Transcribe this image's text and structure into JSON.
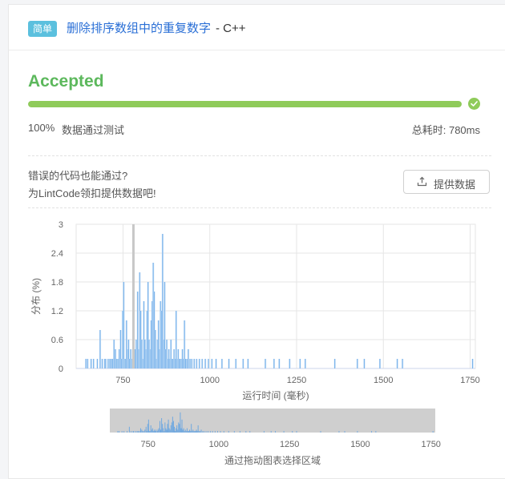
{
  "problem": {
    "difficulty": "简单",
    "title": "删除排序数组中的重复数字",
    "language": "- C++"
  },
  "result": {
    "status": "Accepted",
    "progress": 100,
    "pass_percent": "100%",
    "pass_label": "数据通过测试",
    "runtime_label": "总耗时: 780ms"
  },
  "contribute": {
    "line1": "错误的代码也能通过?",
    "line2": "为LintCode领扣提供数据吧!",
    "button_label": "提供数据"
  },
  "colors": {
    "accepted_green": "#5cb85c",
    "progress_green": "#8fcb5a",
    "badge_blue": "#5bc0de",
    "bar_blue": "#7cb5ec",
    "marker_gray": "#c8c8c8"
  },
  "chart_data": {
    "type": "bar",
    "xlabel": "运行时间 (毫秒)",
    "ylabel": "分布 (%)",
    "xlim": [
      615,
      1765
    ],
    "ylim": [
      0,
      3
    ],
    "x_ticks": [
      750,
      1000,
      1250,
      1500,
      1750
    ],
    "y_ticks": [
      0,
      0.6,
      1.2,
      1.8,
      2.4,
      3
    ],
    "y_tick_labels": [
      "0",
      "0.6",
      "1.2",
      "1.8",
      "2.4",
      "3"
    ],
    "grid": true,
    "current_runtime_marker": 780,
    "bars": {
      "x": [
        643,
        648,
        658,
        665,
        676,
        684,
        690,
        697,
        700,
        707,
        712,
        716,
        720,
        724,
        728,
        731,
        735,
        739,
        743,
        746,
        749,
        752,
        754,
        757,
        760,
        763,
        766,
        769,
        772,
        775,
        778,
        782,
        785,
        788,
        792,
        795,
        798,
        801,
        804,
        807,
        810,
        813,
        816,
        819,
        822,
        825,
        828,
        831,
        834,
        837,
        840,
        843,
        846,
        849,
        852,
        855,
        858,
        861,
        864,
        867,
        870,
        873,
        876,
        879,
        882,
        885,
        888,
        891,
        894,
        897,
        900,
        903,
        906,
        909,
        912,
        915,
        918,
        921,
        924,
        927,
        930,
        934,
        938,
        943,
        948,
        955,
        962,
        970,
        978,
        987,
        996,
        1006,
        1018,
        1035,
        1055,
        1075,
        1096,
        1110,
        1160,
        1185,
        1200,
        1230,
        1260,
        1275,
        1360,
        1425,
        1445,
        1490,
        1540,
        1555,
        1757
      ],
      "values": [
        0.2,
        0.2,
        0.2,
        0.2,
        0.2,
        0.8,
        0.2,
        0.2,
        0.2,
        0.2,
        0.2,
        0.2,
        0.2,
        0.6,
        0.4,
        0.2,
        0.2,
        0.4,
        0.8,
        0.2,
        1.2,
        1.8,
        0.2,
        0.2,
        1.0,
        0.4,
        0.6,
        0.2,
        0.4,
        0.2,
        0.4,
        0.2,
        0.4,
        0.6,
        1.6,
        0.4,
        2.0,
        1.2,
        0.6,
        0.2,
        1.4,
        0.6,
        0.4,
        1.2,
        1.8,
        0.6,
        0.4,
        1.0,
        1.4,
        2.2,
        1.6,
        0.8,
        0.2,
        0.6,
        1.0,
        0.4,
        1.4,
        1.2,
        2.8,
        0.6,
        1.8,
        0.4,
        0.6,
        0.2,
        0.4,
        0.2,
        0.6,
        0.2,
        0.2,
        0.4,
        0.2,
        1.2,
        0.2,
        0.4,
        0.2,
        0.2,
        0.2,
        0.4,
        0.2,
        1.0,
        0.2,
        0.2,
        0.4,
        0.2,
        0.2,
        0.2,
        0.2,
        0.2,
        0.2,
        0.2,
        0.2,
        0.2,
        0.2,
        0.2,
        0.2,
        0.2,
        0.2,
        0.2,
        0.2,
        0.2,
        0.2,
        0.2,
        0.2,
        0.2,
        0.2,
        0.2,
        0.2,
        0.2,
        0.2,
        0.2,
        0.2
      ]
    },
    "navigator": {
      "x_ticks": [
        750,
        1000,
        1250,
        1500,
        1750
      ],
      "caption": "通过拖动图表选择区域"
    }
  }
}
